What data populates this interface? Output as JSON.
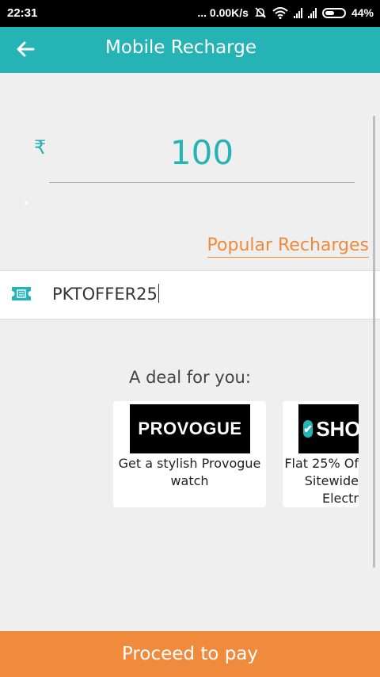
{
  "status_bar": {
    "time": "22:31",
    "network_speed": "... 0.00K/s",
    "battery_percent": "44%",
    "battery_level": 0.44
  },
  "app_bar": {
    "title": "Mobile Recharge",
    "color": "#26b3b5"
  },
  "amount": {
    "currency_symbol": "₹",
    "value": "100"
  },
  "popular_recharges_link": "Popular Recharges",
  "coupon": {
    "code": "PKTOFFER25"
  },
  "deals": {
    "heading": "A deal for you:",
    "items": [
      {
        "logo_text": "PROVOGUE",
        "description": "Get a stylish Provogue watch"
      },
      {
        "logo_text": "SHOP",
        "description": "Flat 25% Of\nSitewide\nElectr"
      }
    ]
  },
  "footer": {
    "proceed_label": "Proceed to pay",
    "color": "#f08a3c"
  },
  "icons": [
    "back-arrow-icon",
    "notification-muted-icon",
    "wifi-icon",
    "signal-icon",
    "battery-icon",
    "ticket-icon",
    "check-badge-icon"
  ]
}
